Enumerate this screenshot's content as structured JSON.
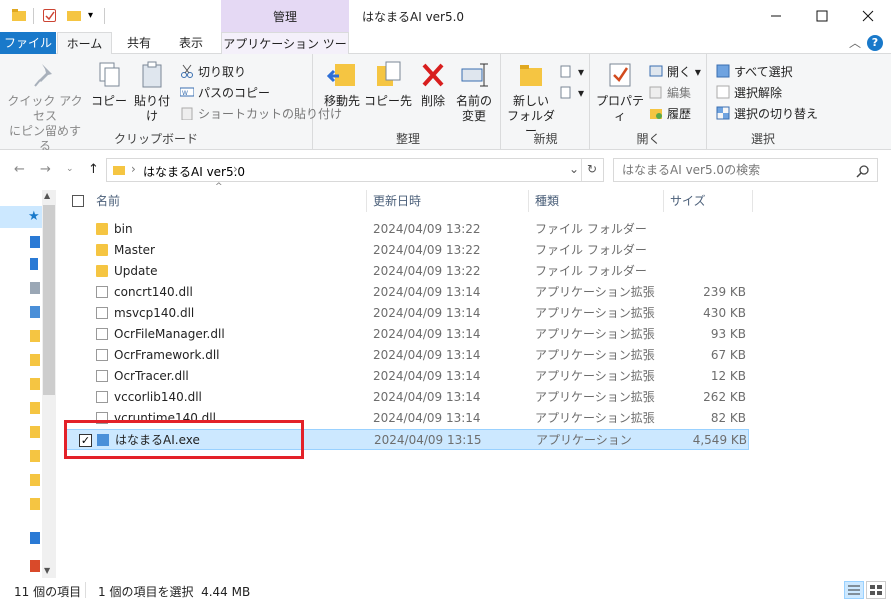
{
  "window": {
    "title": "はなまるAI ver5.0",
    "context_tab_header": "管理",
    "controls": [
      "minimize",
      "maximize",
      "close"
    ]
  },
  "ribbon_tabs": [
    {
      "label": "ファイル"
    },
    {
      "label": "ホーム"
    },
    {
      "label": "共有"
    },
    {
      "label": "表示"
    },
    {
      "label": "アプリケーション ツール"
    }
  ],
  "ribbon": {
    "clipboard": {
      "label": "クリップボード",
      "pin": "クイック アクセス\nにピン留めする",
      "copy": "コピー",
      "paste": "貼り付け",
      "cut": "切り取り",
      "copy_path": "パスのコピー",
      "paste_shortcut": "ショートカットの貼り付け"
    },
    "organize": {
      "label": "整理",
      "move_to": "移動先",
      "copy_to": "コピー先",
      "delete": "削除",
      "rename": "名前の\n変更"
    },
    "new": {
      "label": "新規",
      "new_folder": "新しい\nフォルダー"
    },
    "open": {
      "label": "開く",
      "properties": "プロパティ",
      "open": "開く",
      "edit": "編集",
      "history": "履歴"
    },
    "select": {
      "label": "選択",
      "select_all": "すべて選択",
      "select_none": "選択解除",
      "invert": "選択の切り替え"
    }
  },
  "address": {
    "path": "はなまるAI ver5.0",
    "search_placeholder": "はなまるAI ver5.0の検索"
  },
  "columns": {
    "name": "名前",
    "date": "更新日時",
    "type": "種類",
    "size": "サイズ"
  },
  "files": [
    {
      "name": "bin",
      "date": "2024/04/09 13:22",
      "type": "ファイル フォルダー",
      "size": "",
      "kind": "folder"
    },
    {
      "name": "Master",
      "date": "2024/04/09 13:22",
      "type": "ファイル フォルダー",
      "size": "",
      "kind": "folder"
    },
    {
      "name": "Update",
      "date": "2024/04/09 13:22",
      "type": "ファイル フォルダー",
      "size": "",
      "kind": "folder"
    },
    {
      "name": "concrt140.dll",
      "date": "2024/04/09 13:14",
      "type": "アプリケーション拡張",
      "size": "239 KB",
      "kind": "dll"
    },
    {
      "name": "msvcp140.dll",
      "date": "2024/04/09 13:14",
      "type": "アプリケーション拡張",
      "size": "430 KB",
      "kind": "dll"
    },
    {
      "name": "OcrFileManager.dll",
      "date": "2024/04/09 13:14",
      "type": "アプリケーション拡張",
      "size": "93 KB",
      "kind": "dll"
    },
    {
      "name": "OcrFramework.dll",
      "date": "2024/04/09 13:14",
      "type": "アプリケーション拡張",
      "size": "67 KB",
      "kind": "dll"
    },
    {
      "name": "OcrTracer.dll",
      "date": "2024/04/09 13:14",
      "type": "アプリケーション拡張",
      "size": "12 KB",
      "kind": "dll"
    },
    {
      "name": "vccorlib140.dll",
      "date": "2024/04/09 13:14",
      "type": "アプリケーション拡張",
      "size": "262 KB",
      "kind": "dll"
    },
    {
      "name": "vcruntime140.dll",
      "date": "2024/04/09 13:14",
      "type": "アプリケーション拡張",
      "size": "82 KB",
      "kind": "dll"
    },
    {
      "name": "はなまるAI.exe",
      "date": "2024/04/09 13:15",
      "type": "アプリケーション",
      "size": "4,549 KB",
      "kind": "exe",
      "selected": true
    }
  ],
  "status": {
    "item_count": "11 個の項目",
    "selection": "1 個の項目を選択  4.44 MB"
  },
  "colors": {
    "accent": "#1979ca",
    "context_tab": "#e5d9f4",
    "selection": "#cce8ff",
    "highlight_box": "#e32129"
  }
}
